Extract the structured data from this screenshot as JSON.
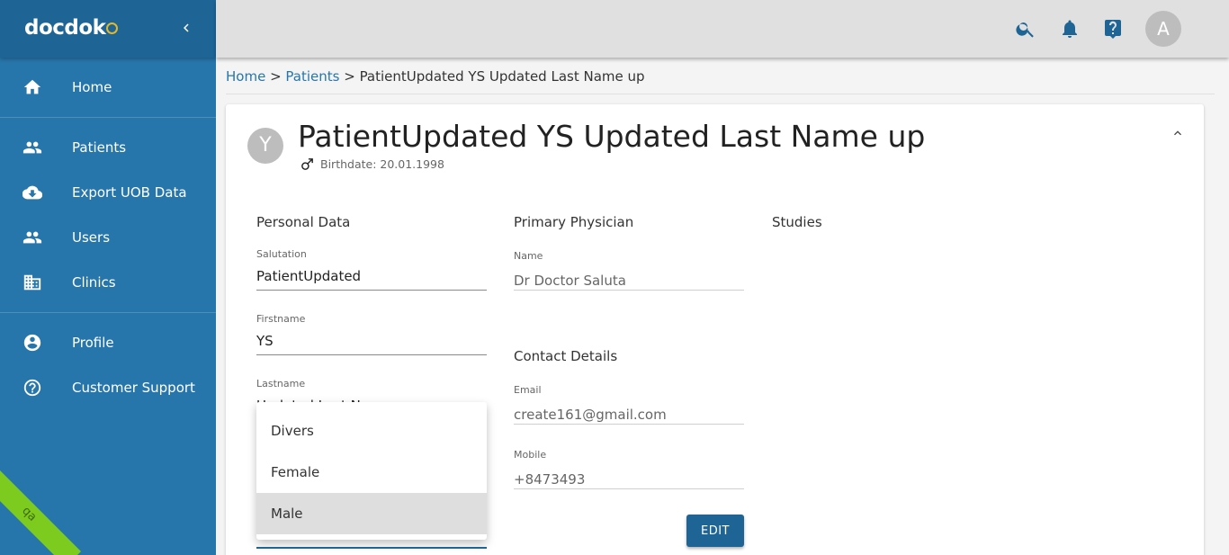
{
  "app": {
    "logo": "docdok",
    "env_badge": "qa"
  },
  "sidebar": {
    "groups": [
      [
        {
          "label": "Home",
          "icon": "home-icon"
        }
      ],
      [
        {
          "label": "Patients",
          "icon": "people-icon"
        },
        {
          "label": "Export UOB Data",
          "icon": "cloud-download-icon"
        },
        {
          "label": "Users",
          "icon": "people-icon"
        },
        {
          "label": "Clinics",
          "icon": "building-icon"
        }
      ],
      [
        {
          "label": "Profile",
          "icon": "account-circle-icon"
        },
        {
          "label": "Customer Support",
          "icon": "help-circle-icon"
        }
      ]
    ]
  },
  "topbar": {
    "avatar_initial": "A",
    "icons": [
      "search-icon",
      "bell-icon",
      "help-icon"
    ]
  },
  "breadcrumb": {
    "home": "Home",
    "sep1": " > ",
    "patients": "Patients",
    "sep2": " > ",
    "current": "PatientUpdated YS Updated Last Name up"
  },
  "patient": {
    "avatar_initial": "Y",
    "full_name": "PatientUpdated YS Updated Last Name up",
    "birthdate": "Birthdate: 20.01.1998",
    "gender_icon": "male-icon"
  },
  "personal_data": {
    "title": "Personal Data",
    "salutation_label": "Salutation",
    "salutation_value": "PatientUpdated",
    "firstname_label": "Firstname",
    "firstname_value": "YS",
    "lastname_label": "Lastname",
    "lastname_value": "Updated Last Na"
  },
  "primary_physician": {
    "title": "Primary Physician",
    "name_label": "Name",
    "name_value": "Dr Doctor Saluta"
  },
  "contact_details": {
    "title": "Contact Details",
    "email_label": "Email",
    "email_value": "create161@gmail.com",
    "mobile_label": "Mobile",
    "mobile_value": "+8473493"
  },
  "studies": {
    "title": "Studies"
  },
  "edit_button": "EDIT",
  "sex_dropdown": {
    "options": [
      "Divers",
      "Female",
      "Male"
    ],
    "selected": "Male"
  }
}
